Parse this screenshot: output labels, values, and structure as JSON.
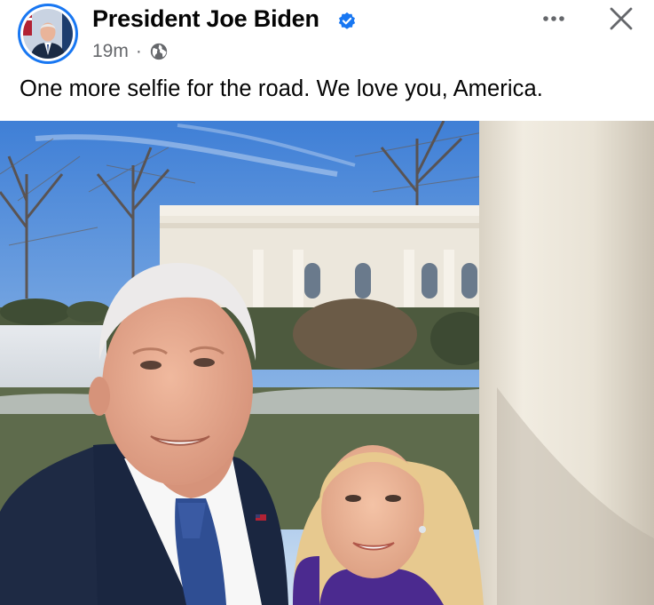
{
  "post": {
    "author": {
      "name": "President Joe Biden",
      "verified_icon": "verified-badge-icon",
      "avatar": "profile-photo"
    },
    "meta": {
      "time": "19m",
      "separator": "·",
      "audience_icon": "globe-icon"
    },
    "actions": {
      "more_icon": "more-options-icon",
      "close_icon": "close-icon"
    },
    "caption": "One more selfie for the road. We love you, America.",
    "photo": {
      "description_icon": "selfie-photo"
    }
  },
  "colors": {
    "brand_blue": "#1877f2",
    "text_primary": "#050505",
    "text_secondary": "#65676b"
  }
}
